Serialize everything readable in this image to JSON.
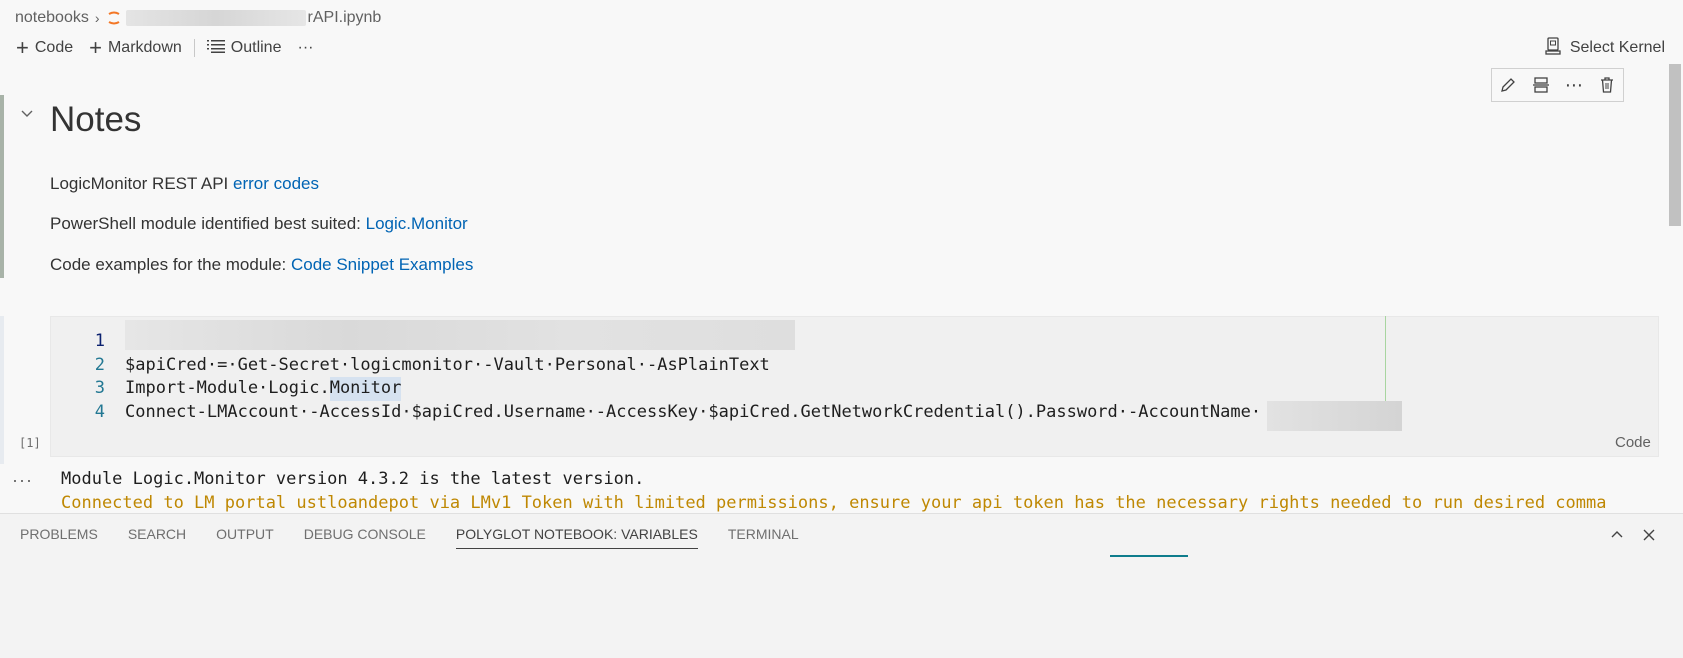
{
  "breadcrumb": {
    "root": "notebooks",
    "file_suffix": "rAPI.ipynb"
  },
  "toolbar": {
    "code_label": "Code",
    "markdown_label": "Markdown",
    "outline_label": "Outline",
    "more_label": "···",
    "kernel_label": "Select Kernel"
  },
  "markdown_cell": {
    "title": "Notes",
    "line1_text": "LogicMonitor REST API ",
    "line1_link": "error codes",
    "line2_text": "PowerShell module identified best suited: ",
    "line2_link": "Logic.Monitor",
    "line3_text": "Code examples for the module: ",
    "line3_link": "Code Snippet Examples"
  },
  "code_cell": {
    "line_numbers": [
      "1",
      "2",
      "3",
      "4"
    ],
    "line2": "$apiCred·=·Get-Secret·logicmonitor·-Vault·Personal·-AsPlainText",
    "line3_prefix": "Import-Module·Logic.",
    "line3_highlight": "Monitor",
    "line4": "Connect-LMAccount·-AccessId·$apiCred.Username·-AccessKey·$apiCred.GetNetworkCredential().Password·-AccountName·",
    "execution_count": "[1]",
    "language": "Code"
  },
  "output": {
    "more": "···",
    "line1": "Module Logic.Monitor version 4.3.2 is the latest version.",
    "line2": "Connected to LM portal ustloandepot via LMv1 Token with limited permissions, ensure your api token has the necessary rights needed to run desired comma"
  },
  "panel": {
    "tabs": [
      "PROBLEMS",
      "SEARCH",
      "OUTPUT",
      "DEBUG CONSOLE",
      "POLYGLOT NOTEBOOK: VARIABLES",
      "TERMINAL"
    ],
    "active_tab": "POLYGLOT NOTEBOOK: VARIABLES"
  },
  "colors": {
    "link": "#0064b4",
    "warning_output": "#bf8803",
    "accent": "#0e7c8c"
  }
}
